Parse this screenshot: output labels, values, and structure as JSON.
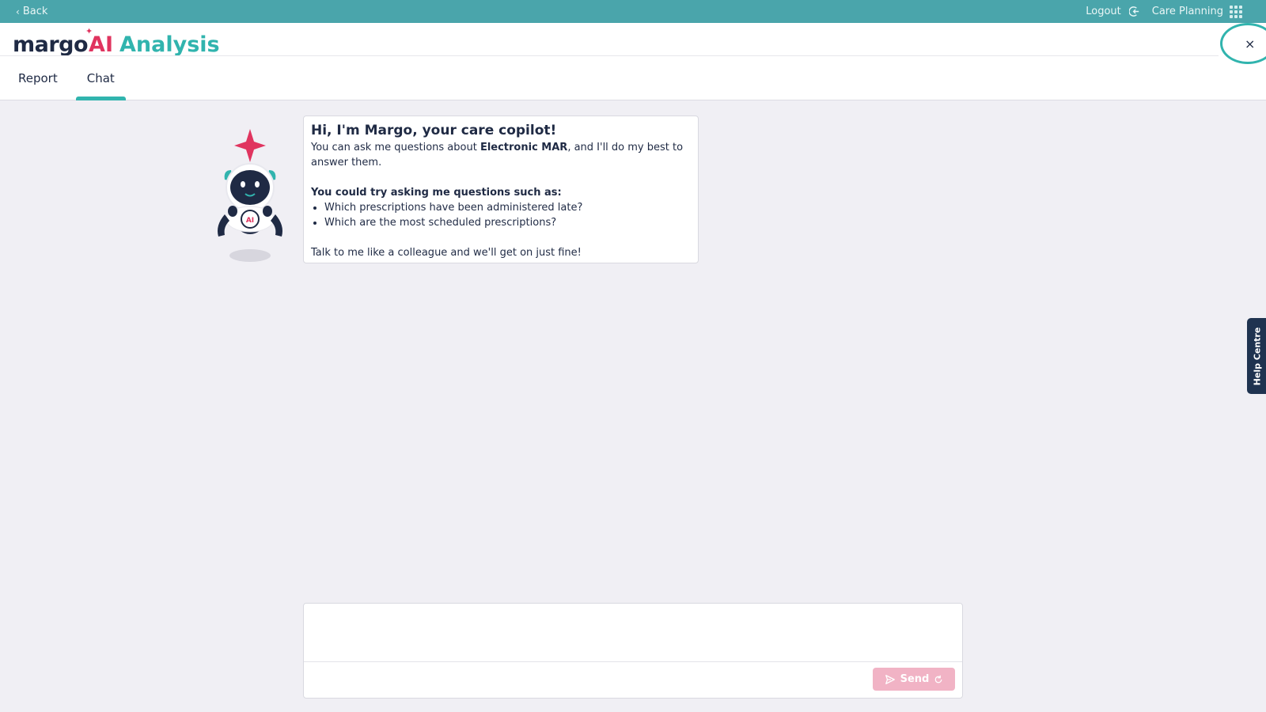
{
  "topbar": {
    "back_label": "Back",
    "logout_label": "Logout",
    "app_switch_label": "Care Planning"
  },
  "header": {
    "logo_margo": "margo",
    "logo_ai": "AI",
    "logo_analysis": "Analysis",
    "close_glyph": "×",
    "tabs": [
      {
        "label": "Report",
        "active": false
      },
      {
        "label": "Chat",
        "active": true
      }
    ]
  },
  "chat": {
    "title": "Hi, I'm Margo, your care copilot!",
    "intro_prefix": "You can ask me questions about ",
    "intro_bold": "Electronic MAR",
    "intro_suffix": ", and I'll do my best to answer them.",
    "suggest_heading": "You could try asking me questions such as:",
    "suggestions": [
      "Which prescriptions have been administered late?",
      "Which are the most scheduled prescriptions?"
    ],
    "closing": "Talk to me like a colleague and we'll get on just fine!"
  },
  "help_centre_label": "Help Centre",
  "composer": {
    "placeholder": "",
    "send_label": "Send"
  },
  "colors": {
    "topbar": "#4aa5ab",
    "accent_teal": "#31b4ae",
    "brand_pink": "#e0345f",
    "navy": "#1f2a44",
    "send_disabled": "#f1b3c5"
  }
}
